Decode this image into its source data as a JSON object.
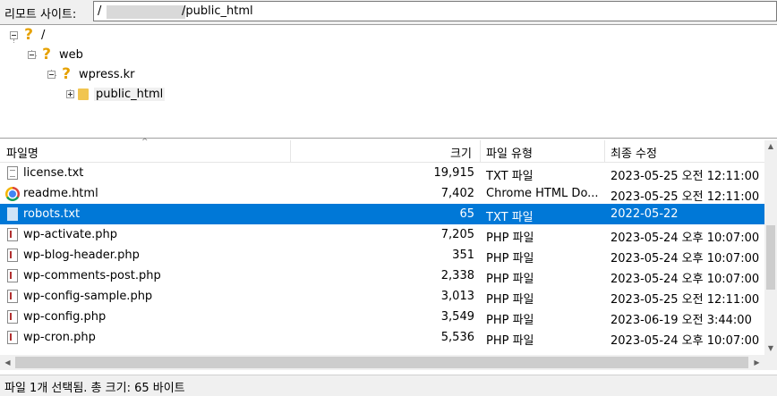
{
  "pathbar": {
    "label": "리모트 사이트:",
    "path_prefix": "/",
    "path_suffix": "/public_html"
  },
  "tree": [
    {
      "label": "/",
      "icon": "question-icon"
    },
    {
      "label": "web",
      "icon": "question-icon"
    },
    {
      "label": "wpress.kr",
      "icon": "question-icon"
    },
    {
      "label": "public_html",
      "icon": "folder-icon"
    }
  ],
  "columns": {
    "name": "파일명",
    "size": "크기",
    "type": "파일 유형",
    "modified": "최종 수정"
  },
  "files": [
    {
      "name": "license.txt",
      "size": "19,915",
      "type": "TXT 파일",
      "modified": "2023-05-25 오전 12:11:00",
      "icon": "text-file-icon"
    },
    {
      "name": "readme.html",
      "size": "7,402",
      "type": "Chrome HTML Do...",
      "modified": "2023-05-25 오전 12:11:00",
      "icon": "chrome-icon"
    },
    {
      "name": "robots.txt",
      "size": "65",
      "type": "TXT 파일",
      "modified": "2022-05-22",
      "icon": "text-file-icon",
      "selected": true
    },
    {
      "name": "wp-activate.php",
      "size": "7,205",
      "type": "PHP 파일",
      "modified": "2023-05-24 오후 10:07:00",
      "icon": "php-file-icon"
    },
    {
      "name": "wp-blog-header.php",
      "size": "351",
      "type": "PHP 파일",
      "modified": "2023-05-24 오후 10:07:00",
      "icon": "php-file-icon"
    },
    {
      "name": "wp-comments-post.php",
      "size": "2,338",
      "type": "PHP 파일",
      "modified": "2023-05-24 오후 10:07:00",
      "icon": "php-file-icon"
    },
    {
      "name": "wp-config-sample.php",
      "size": "3,013",
      "type": "PHP 파일",
      "modified": "2023-05-25 오전 12:11:00",
      "icon": "php-file-icon"
    },
    {
      "name": "wp-config.php",
      "size": "3,549",
      "type": "PHP 파일",
      "modified": "2023-06-19 오전 3:44:00",
      "icon": "php-file-icon"
    },
    {
      "name": "wp-cron.php",
      "size": "5,536",
      "type": "PHP 파일",
      "modified": "2023-05-24 오후 10:07:00",
      "icon": "php-file-icon"
    }
  ],
  "status": {
    "text": "파일 1개 선택됨. 총 크기: 65 바이트"
  },
  "colors": {
    "selection": "#0078d7",
    "tree_icon": "#e6a100",
    "folder": "#f1c550"
  }
}
